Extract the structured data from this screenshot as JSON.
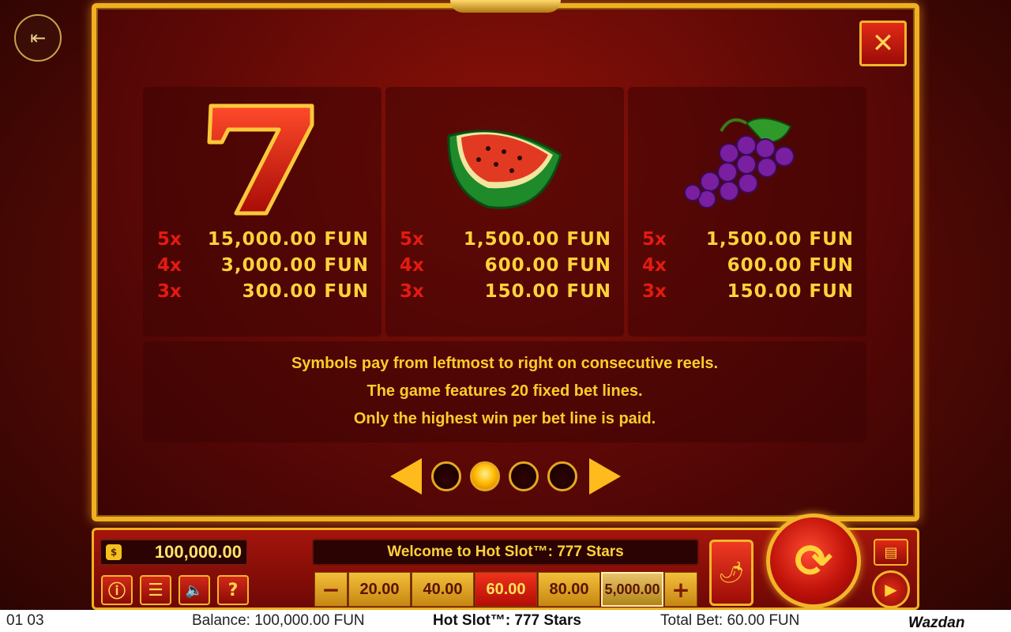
{
  "panel": {
    "symbols": [
      {
        "name": "seven",
        "pays": [
          {
            "mult": "5x",
            "value": "15,000.00 FUN"
          },
          {
            "mult": "4x",
            "value": "3,000.00 FUN"
          },
          {
            "mult": "3x",
            "value": "300.00 FUN"
          }
        ]
      },
      {
        "name": "watermelon",
        "pays": [
          {
            "mult": "5x",
            "value": "1,500.00 FUN"
          },
          {
            "mult": "4x",
            "value": "600.00 FUN"
          },
          {
            "mult": "3x",
            "value": "150.00 FUN"
          }
        ]
      },
      {
        "name": "grapes",
        "pays": [
          {
            "mult": "5x",
            "value": "1,500.00 FUN"
          },
          {
            "mult": "4x",
            "value": "600.00 FUN"
          },
          {
            "mult": "3x",
            "value": "150.00 FUN"
          }
        ]
      }
    ],
    "rules": [
      "Symbols pay from leftmost to right on consecutive reels.",
      "The game features 20 fixed bet lines.",
      "Only the highest win per bet line is paid."
    ],
    "pager": {
      "pages": 4,
      "active_page": 2
    },
    "close_icon": "close-icon"
  },
  "controls": {
    "balance": "100,000.00",
    "welcome": "Welcome to Hot Slot™: 777 Stars",
    "help_label": "?",
    "bet_minus": "−",
    "bet_plus": "+",
    "bets": [
      "20.00",
      "40.00",
      "60.00",
      "80.00",
      "5,000.00"
    ],
    "selected_bet": "60.00",
    "max_bet": "5,000.00"
  },
  "status": {
    "time": "01 03",
    "balance": "Balance: 100,000.00 FUN",
    "game": "Hot Slot™: 777 Stars",
    "total_bet": "Total Bet: 60.00 FUN",
    "brand": "Wazdan"
  },
  "colors": {
    "gold": "#f0b020",
    "red": "#e41b10",
    "payout_text": "#ffd23a"
  }
}
